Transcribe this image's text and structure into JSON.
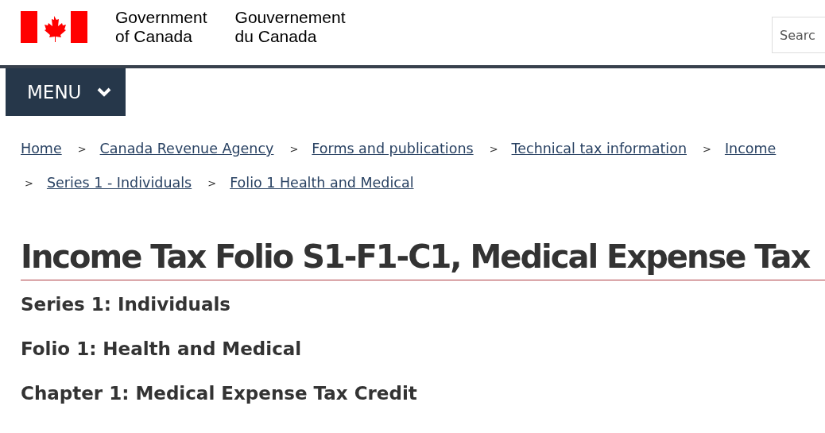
{
  "header": {
    "signature_en": [
      "Government",
      "of Canada"
    ],
    "signature_fr": [
      "Gouvernement",
      "du Canada"
    ],
    "search": {
      "placeholder": "Searc"
    }
  },
  "menu": {
    "label": "MENU",
    "expanded": false
  },
  "breadcrumb": [
    {
      "label": "Home"
    },
    {
      "separator": ">",
      "label": "Canada Revenue Agency"
    },
    {
      "separator": ">",
      "label": "Forms and publications"
    },
    {
      "separator": ">",
      "label": "Technical tax information"
    },
    {
      "separator": ">",
      "label": "Income"
    },
    {
      "separator": ">",
      "label": "Series 1 - Individuals"
    },
    {
      "separator": ">",
      "label": "Folio 1 Health and Medical"
    }
  ],
  "title": "Income Tax Folio S1-F1-C1, Medical Expense Tax",
  "subheadings": [
    "Series 1: Individuals",
    "Folio 1: Health and Medical",
    "Chapter 1: Medical Expense Tax Credit"
  ]
}
